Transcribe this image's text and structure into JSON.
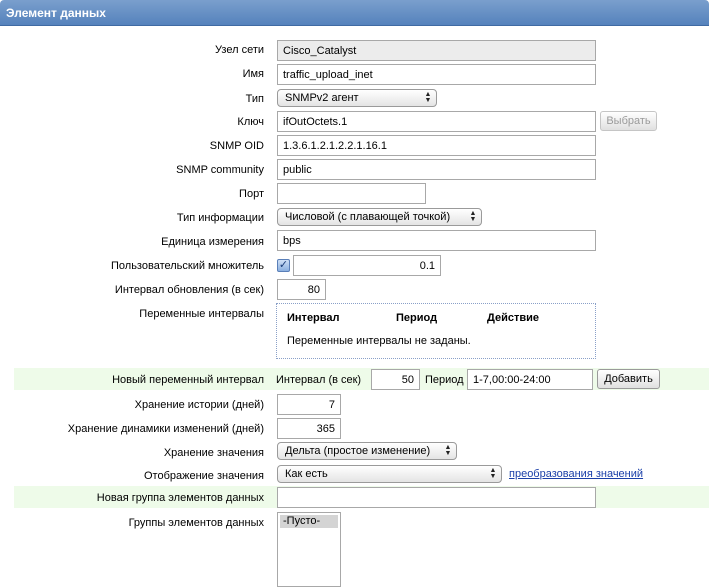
{
  "header": {
    "title": "Элемент данных"
  },
  "form": {
    "host": {
      "label": "Узел сети",
      "value": "Cisco_Catalyst"
    },
    "name": {
      "label": "Имя",
      "value": "traffic_upload_inet"
    },
    "type": {
      "label": "Тип",
      "value": "SNMPv2 агент"
    },
    "key": {
      "label": "Ключ",
      "value": "ifOutOctets.1",
      "button": "Выбрать"
    },
    "snmp_oid": {
      "label": "SNMP OID",
      "value": "1.3.6.1.2.1.2.2.1.16.1"
    },
    "snmp_community": {
      "label": "SNMP community",
      "value": "public"
    },
    "port": {
      "label": "Порт",
      "value": ""
    },
    "info_type": {
      "label": "Тип информации",
      "value": "Числовой (с плавающей точкой)"
    },
    "units": {
      "label": "Единица измерения",
      "value": "bps"
    },
    "multiplier": {
      "label": "Пользовательский множитель",
      "checked": true,
      "value": "0.1"
    },
    "update_interval": {
      "label": "Интервал обновления (в сек)",
      "value": "80"
    },
    "flex_intervals": {
      "label": "Переменные интервалы",
      "columns": [
        "Интервал",
        "Период",
        "Действие"
      ],
      "empty_text": "Переменные интервалы не заданы."
    },
    "new_flex_interval": {
      "label": "Новый переменный интервал",
      "interval_label": "Интервал (в сек)",
      "interval_value": "50",
      "period_label": "Период",
      "period_value": "1-7,00:00-24:00",
      "add_button": "Добавить"
    },
    "history": {
      "label": "Хранение истории (дней)",
      "value": "7"
    },
    "trends": {
      "label": "Хранение динамики изменений (дней)",
      "value": "365"
    },
    "store_value": {
      "label": "Хранение значения",
      "value": "Дельта (простое изменение)"
    },
    "show_value": {
      "label": "Отображение значения",
      "value": "Как есть",
      "link": "преобразования значений"
    },
    "new_application": {
      "label": "Новая группа элементов данных",
      "value": ""
    },
    "applications": {
      "label": "Группы элементов данных",
      "options": [
        "-Пусто-"
      ]
    }
  }
}
